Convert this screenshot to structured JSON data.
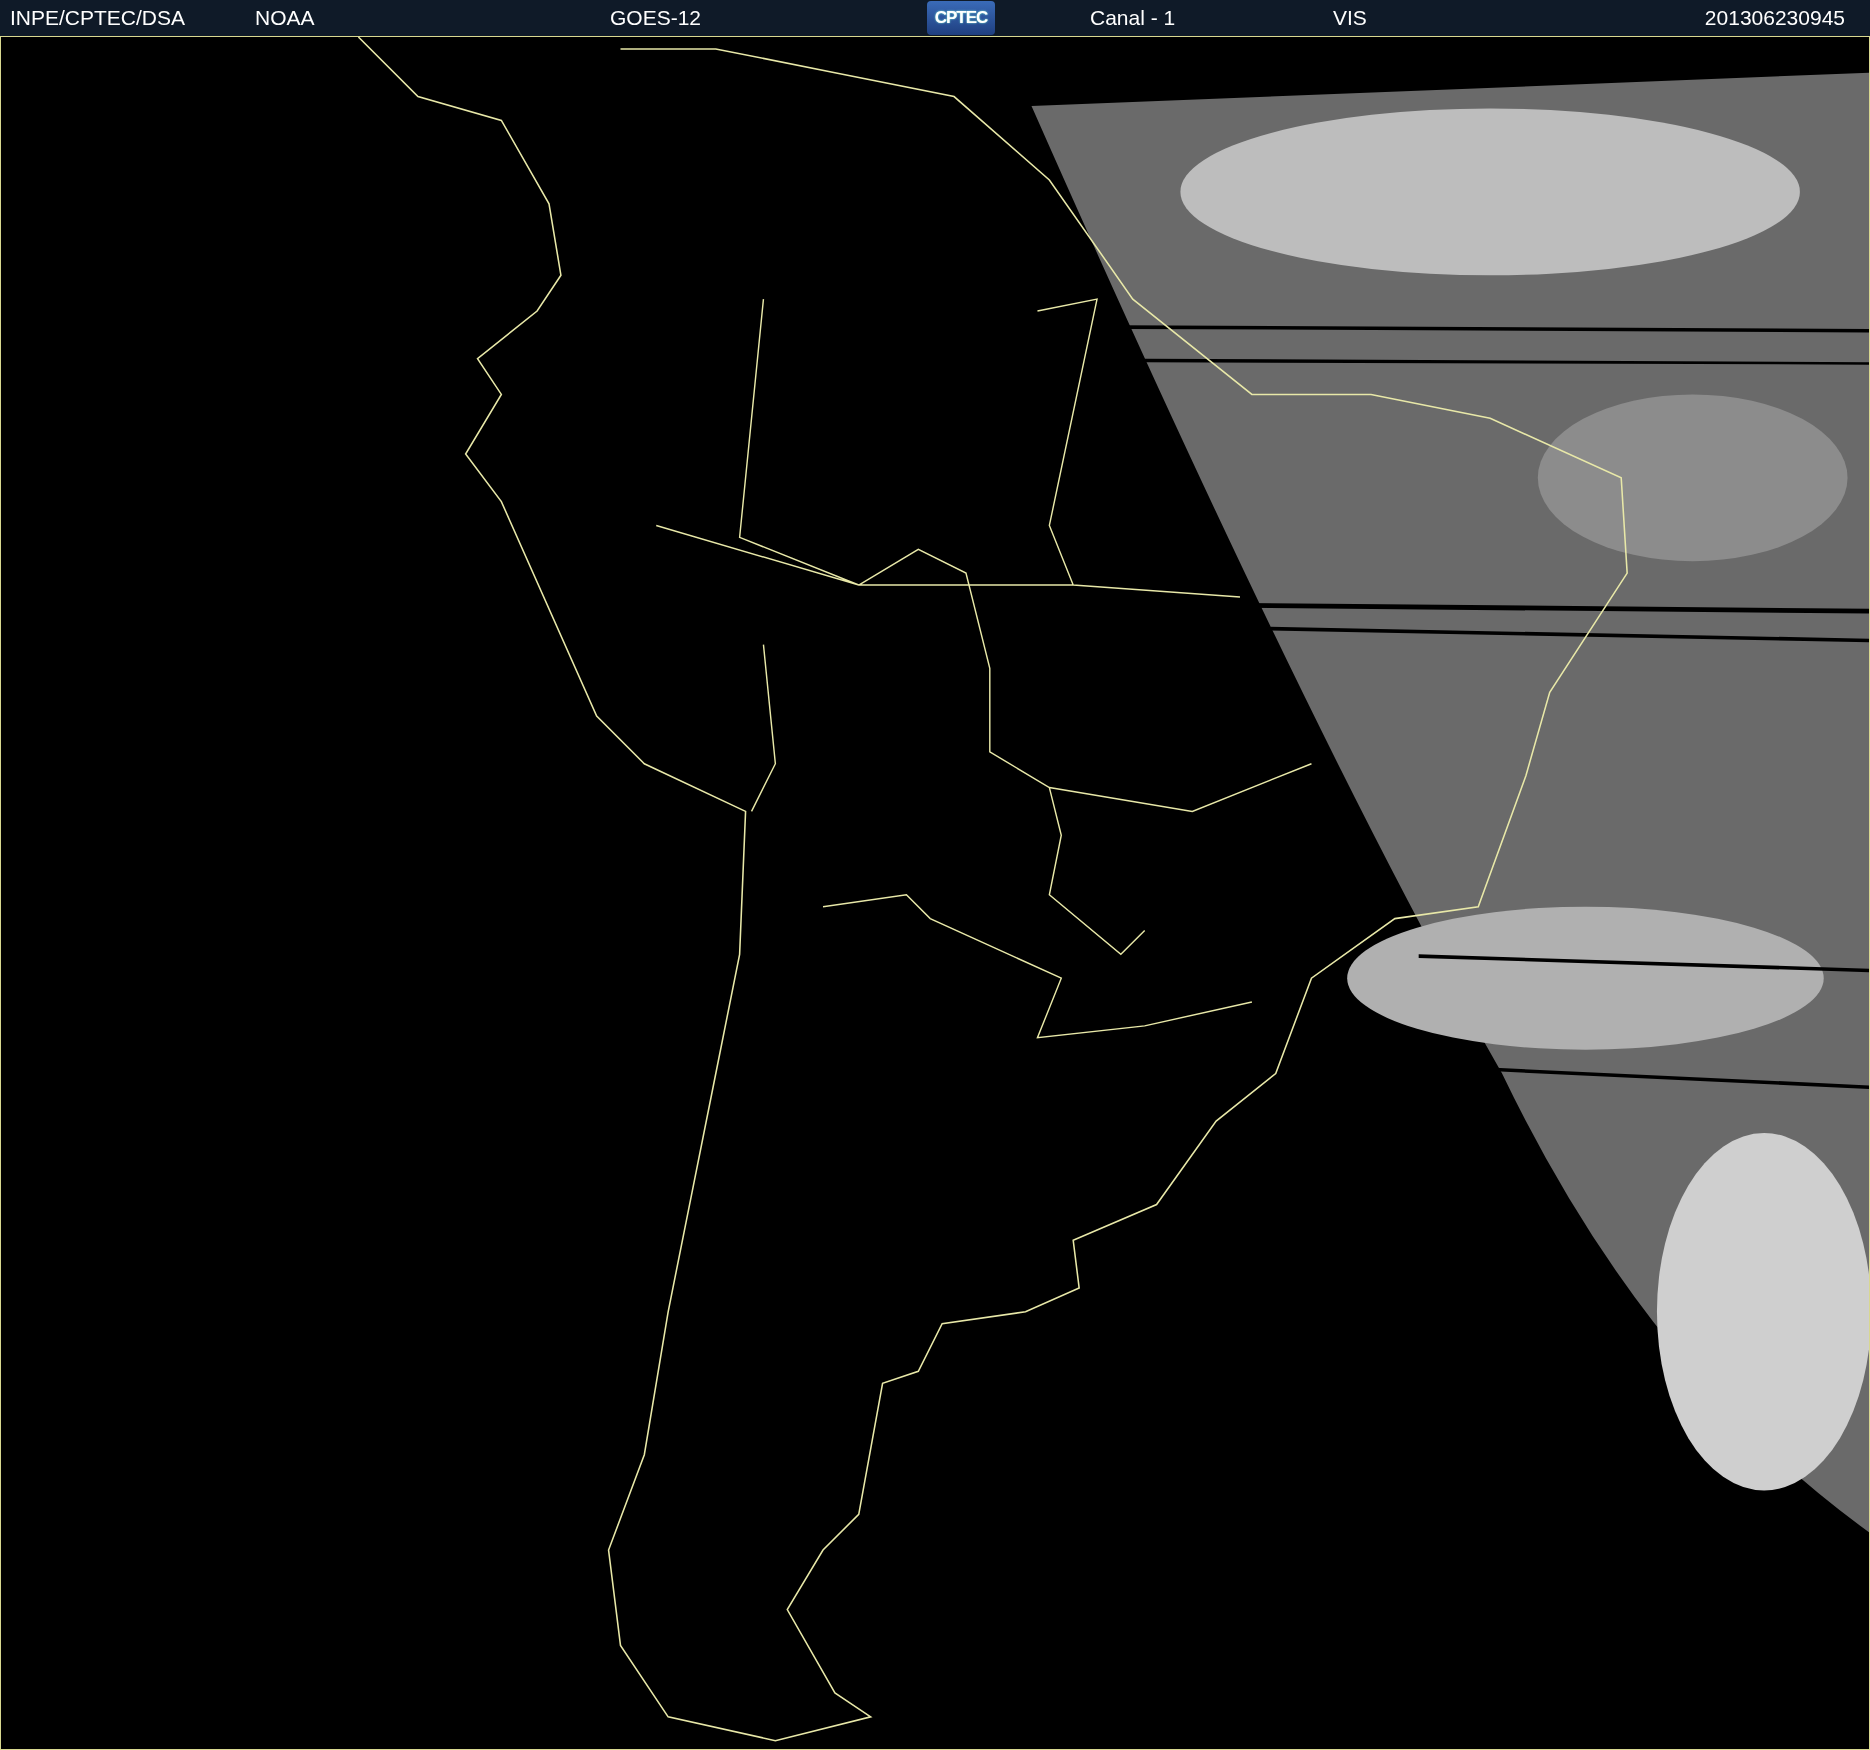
{
  "header": {
    "items": [
      {
        "kind": "text",
        "label": "INPE/CPTEC/DSA"
      },
      {
        "kind": "text",
        "label": "NOAA"
      },
      {
        "kind": "text",
        "label": "GOES-12"
      },
      {
        "kind": "logo",
        "label": "CPTEC"
      },
      {
        "kind": "text",
        "label": "Canal - 1"
      },
      {
        "kind": "text",
        "label": "VIS"
      },
      {
        "kind": "text",
        "label": "201306230945"
      }
    ]
  }
}
